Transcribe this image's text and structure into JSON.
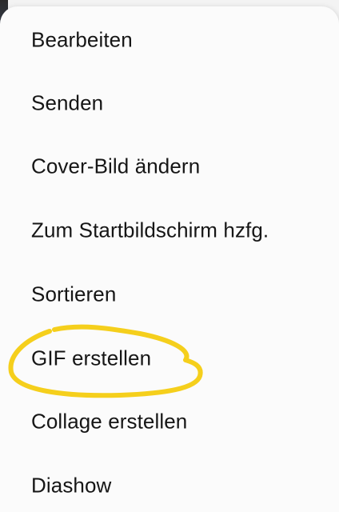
{
  "menu": {
    "items": [
      {
        "label": "Bearbeiten"
      },
      {
        "label": "Senden"
      },
      {
        "label": "Cover-Bild ändern"
      },
      {
        "label": "Zum Startbildschirm hzfg."
      },
      {
        "label": "Sortieren"
      },
      {
        "label": "GIF erstellen"
      },
      {
        "label": "Collage erstellen"
      },
      {
        "label": "Diashow"
      }
    ]
  },
  "annotation": {
    "circled_item": "GIF erstellen",
    "color": "#f5cf1c"
  },
  "colors": {
    "menu_background": "#fbfbfb",
    "text": "#161616"
  }
}
